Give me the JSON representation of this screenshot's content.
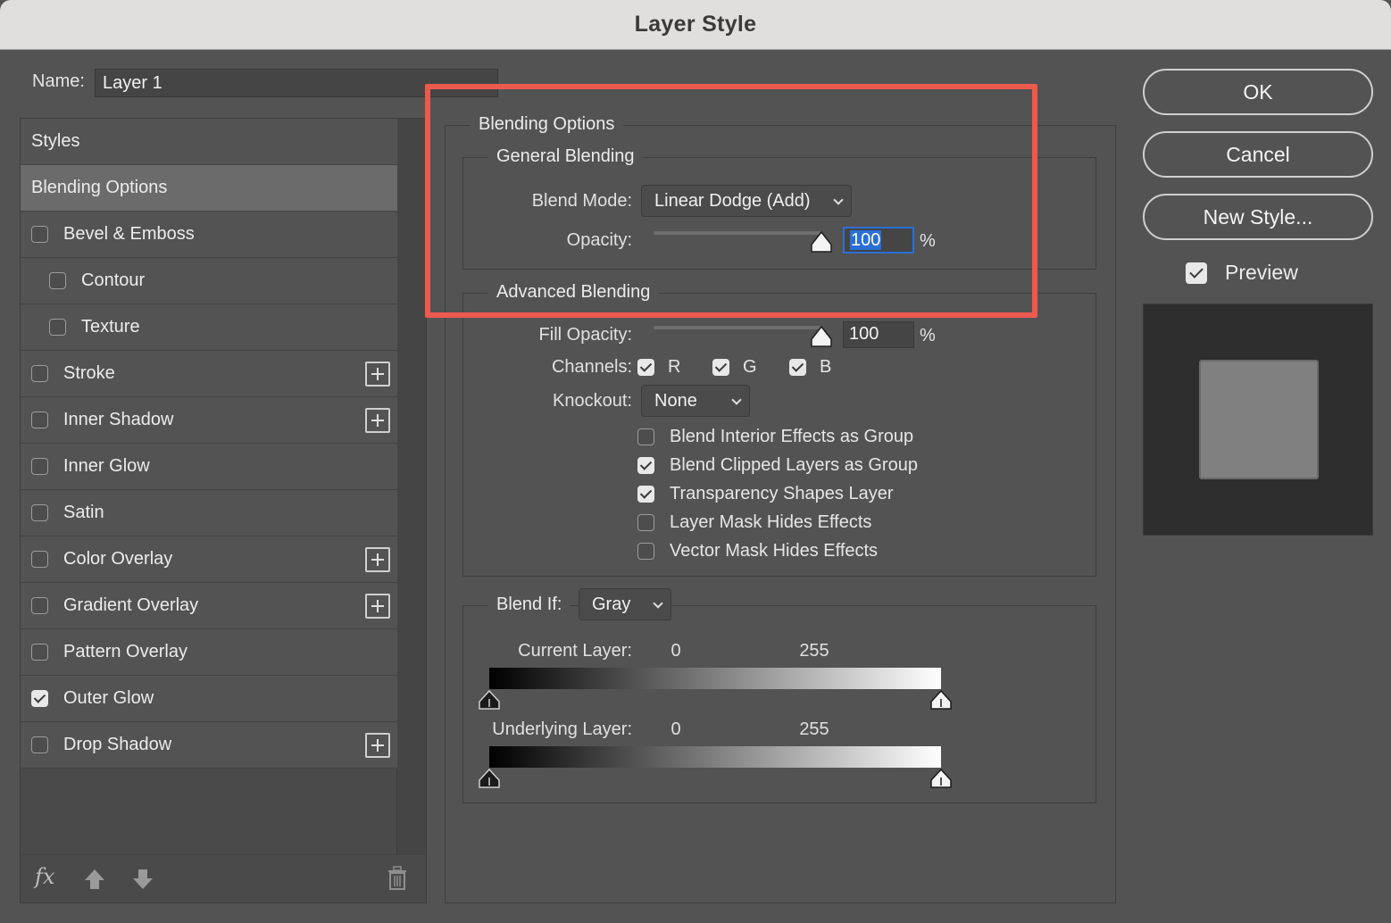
{
  "window": {
    "title": "Layer Style"
  },
  "name_field": {
    "label": "Name:",
    "value": "Layer 1"
  },
  "styles_list": {
    "header": "Styles",
    "items": [
      {
        "label": "Blending Options",
        "checkbox": false,
        "checked": false,
        "plus": false,
        "selected": true,
        "indent": false
      },
      {
        "label": "Bevel & Emboss",
        "checkbox": true,
        "checked": false,
        "plus": false,
        "selected": false,
        "indent": false
      },
      {
        "label": "Contour",
        "checkbox": true,
        "checked": false,
        "plus": false,
        "selected": false,
        "indent": true
      },
      {
        "label": "Texture",
        "checkbox": true,
        "checked": false,
        "plus": false,
        "selected": false,
        "indent": true
      },
      {
        "label": "Stroke",
        "checkbox": true,
        "checked": false,
        "plus": true,
        "selected": false,
        "indent": false
      },
      {
        "label": "Inner Shadow",
        "checkbox": true,
        "checked": false,
        "plus": true,
        "selected": false,
        "indent": false
      },
      {
        "label": "Inner Glow",
        "checkbox": true,
        "checked": false,
        "plus": false,
        "selected": false,
        "indent": false
      },
      {
        "label": "Satin",
        "checkbox": true,
        "checked": false,
        "plus": false,
        "selected": false,
        "indent": false
      },
      {
        "label": "Color Overlay",
        "checkbox": true,
        "checked": false,
        "plus": true,
        "selected": false,
        "indent": false
      },
      {
        "label": "Gradient Overlay",
        "checkbox": true,
        "checked": false,
        "plus": true,
        "selected": false,
        "indent": false
      },
      {
        "label": "Pattern Overlay",
        "checkbox": true,
        "checked": false,
        "plus": false,
        "selected": false,
        "indent": false
      },
      {
        "label": "Outer Glow",
        "checkbox": true,
        "checked": true,
        "plus": false,
        "selected": false,
        "indent": false
      },
      {
        "label": "Drop Shadow",
        "checkbox": true,
        "checked": false,
        "plus": true,
        "selected": false,
        "indent": false
      }
    ],
    "footer": {
      "fx_label": "fx",
      "icons": [
        "fx-icon",
        "arrow-up-icon",
        "arrow-down-icon",
        "trash-icon"
      ]
    }
  },
  "blending_options": {
    "title": "Blending Options",
    "general": {
      "title": "General Blending",
      "blend_mode_label": "Blend Mode:",
      "blend_mode_value": "Linear Dodge (Add)",
      "opacity_label": "Opacity:",
      "opacity_value": "100",
      "opacity_unit": "%",
      "opacity_fraction": 1.0
    },
    "advanced": {
      "title": "Advanced Blending",
      "fill_opacity_label": "Fill Opacity:",
      "fill_opacity_value": "100",
      "fill_opacity_unit": "%",
      "fill_opacity_fraction": 1.0,
      "channels_label": "Channels:",
      "channels": [
        {
          "label": "R",
          "checked": true
        },
        {
          "label": "G",
          "checked": true
        },
        {
          "label": "B",
          "checked": true
        }
      ],
      "knockout_label": "Knockout:",
      "knockout_value": "None",
      "options": [
        {
          "label": "Blend Interior Effects as Group",
          "checked": false
        },
        {
          "label": "Blend Clipped Layers as Group",
          "checked": true
        },
        {
          "label": "Transparency Shapes Layer",
          "checked": true
        },
        {
          "label": "Layer Mask Hides Effects",
          "checked": false
        },
        {
          "label": "Vector Mask Hides Effects",
          "checked": false
        }
      ]
    },
    "blend_if": {
      "label": "Blend If:",
      "value": "Gray",
      "current_layer": {
        "label": "Current Layer:",
        "min": "0",
        "max": "255"
      },
      "underlying_layer": {
        "label": "Underlying Layer:",
        "min": "0",
        "max": "255"
      }
    }
  },
  "buttons": {
    "ok": "OK",
    "cancel": "Cancel",
    "new_style": "New Style..."
  },
  "preview": {
    "label": "Preview",
    "checked": true
  },
  "colors": {
    "highlight": "#ec5a4f",
    "focus": "#2a6fd6",
    "panel": "#535353",
    "swatch": "#808080"
  }
}
